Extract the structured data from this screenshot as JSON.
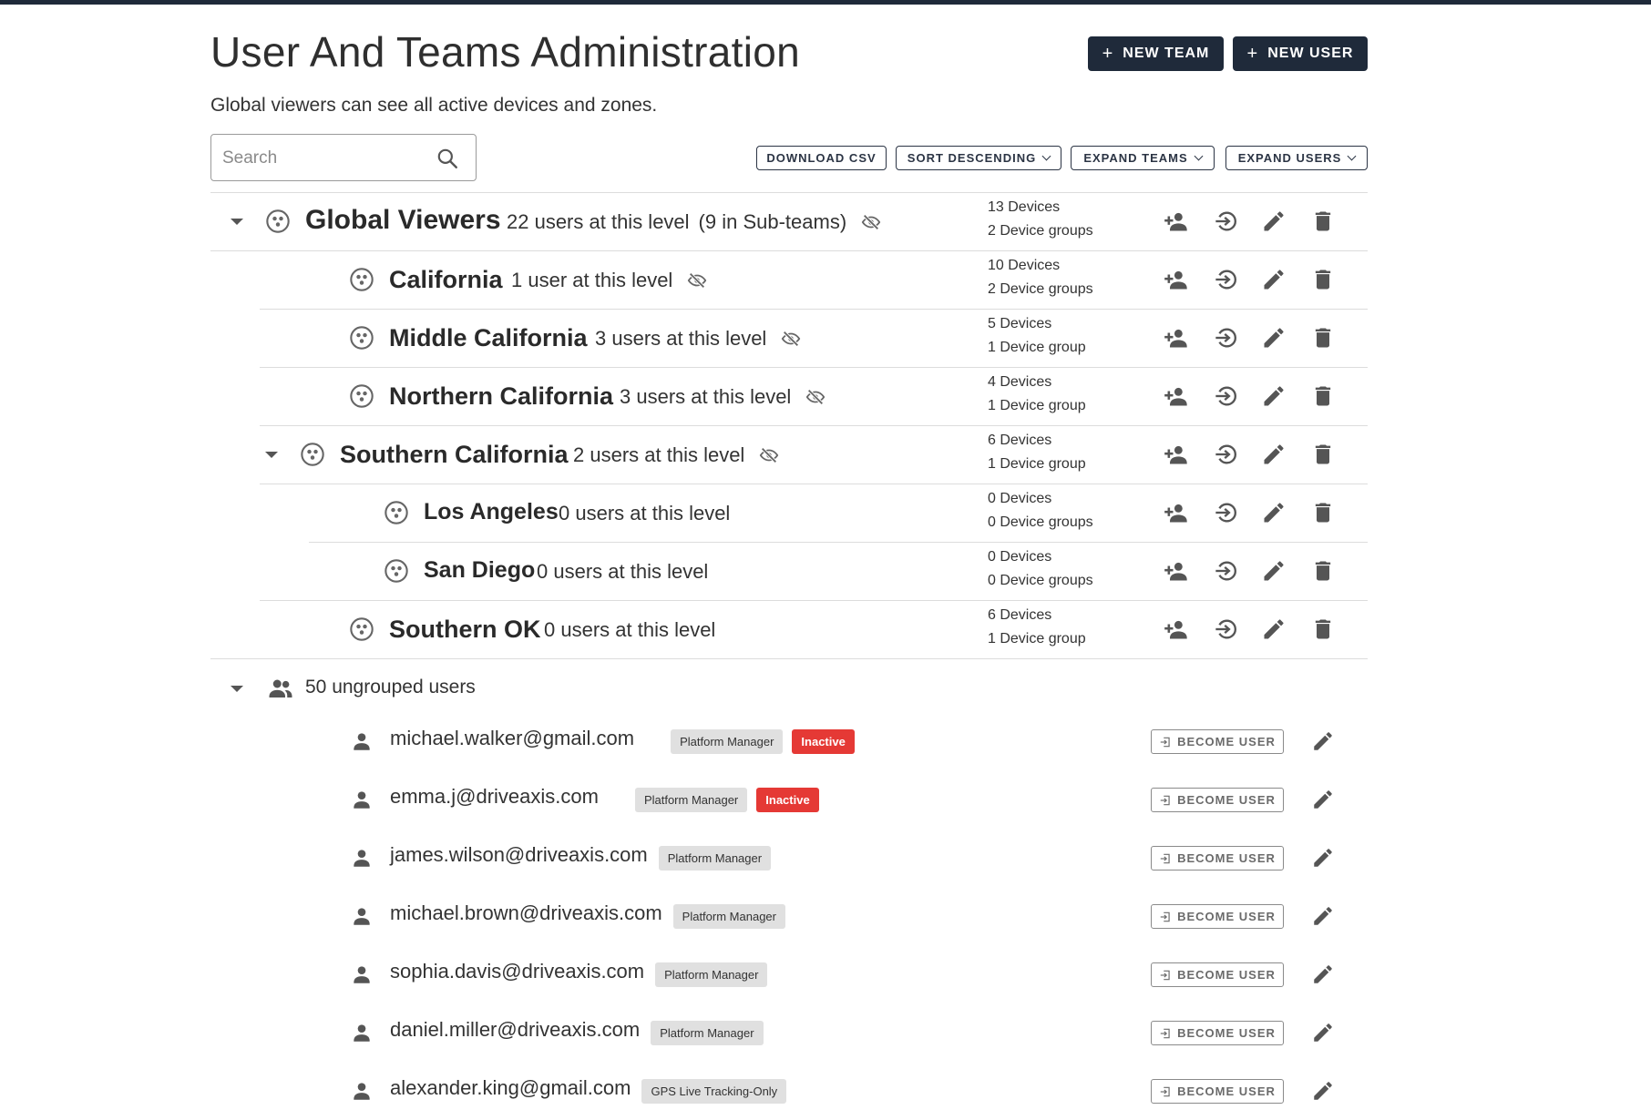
{
  "header": {
    "title": "User And Teams Administration",
    "subtitle": "Global viewers can see all active devices and zones.",
    "new_team_label": "NEW TEAM",
    "new_user_label": "NEW USER"
  },
  "toolbar": {
    "search_placeholder": "Search",
    "download_csv": "DOWNLOAD CSV",
    "sort_descending": "SORT DESCENDING",
    "expand_teams": "EXPAND TEAMS",
    "expand_users": "EXPAND USERS"
  },
  "teams": [
    {
      "name": "Global Viewers",
      "users": "22 users at this level",
      "extra": "(9 in Sub-teams)",
      "devices": "13 Devices",
      "groups": "2 Device groups"
    },
    {
      "name": "California",
      "users": "1 user at this level",
      "devices": "10 Devices",
      "groups": "2 Device groups"
    },
    {
      "name": "Middle California",
      "users": "3 users at this level",
      "devices": "5 Devices",
      "groups": "1 Device group"
    },
    {
      "name": "Northern California",
      "users": "3 users at this level",
      "devices": "4 Devices",
      "groups": "1 Device group"
    },
    {
      "name": "Southern California",
      "users": "2 users at this level",
      "devices": "6 Devices",
      "groups": "1 Device group"
    },
    {
      "name": "Los Angeles",
      "users": "0 users at this level",
      "devices": "0 Devices",
      "groups": "0 Device groups"
    },
    {
      "name": "San Diego",
      "users": "0 users at this level",
      "devices": "0 Devices",
      "groups": "0 Device groups"
    },
    {
      "name": "Southern OK",
      "users": "0 users at this level",
      "devices": "6 Devices",
      "groups": "1 Device group"
    }
  ],
  "ungrouped": {
    "label": "50 ungrouped users",
    "become_label": "BECOME USER",
    "users": [
      {
        "email": "michael.walker@gmail.com",
        "role": "Platform Manager",
        "status": "Inactive"
      },
      {
        "email": "emma.j@driveaxis.com",
        "role": "Platform Manager",
        "status": "Inactive"
      },
      {
        "email": "james.wilson@driveaxis.com",
        "role": "Platform Manager"
      },
      {
        "email": "michael.brown@driveaxis.com",
        "role": "Platform Manager"
      },
      {
        "email": "sophia.davis@driveaxis.com",
        "role": "Platform Manager"
      },
      {
        "email": "daniel.miller@driveaxis.com",
        "role": "Platform Manager"
      },
      {
        "email": "alexander.king@gmail.com",
        "role": "GPS Live Tracking-Only"
      }
    ]
  },
  "colors": {
    "primary_dark": "#1f2a3a",
    "inactive_red": "#e53935",
    "chip_gray": "#e0e0e0"
  }
}
